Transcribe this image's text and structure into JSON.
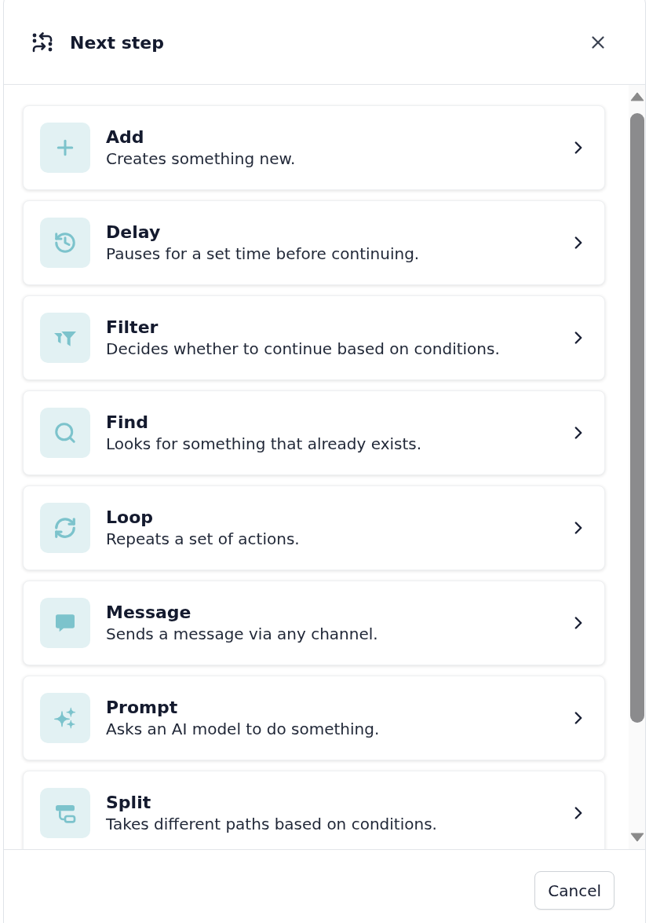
{
  "dialog": {
    "title": "Next step"
  },
  "steps": [
    {
      "kind": "add",
      "title": "Add",
      "description": "Creates something new."
    },
    {
      "kind": "delay",
      "title": "Delay",
      "description": "Pauses for a set time before continuing."
    },
    {
      "kind": "filter",
      "title": "Filter",
      "description": "Decides whether to continue based on conditions."
    },
    {
      "kind": "find",
      "title": "Find",
      "description": "Looks for something that already exists."
    },
    {
      "kind": "loop",
      "title": "Loop",
      "description": "Repeats a set of actions."
    },
    {
      "kind": "message",
      "title": "Message",
      "description": "Sends a message via any channel."
    },
    {
      "kind": "prompt",
      "title": "Prompt",
      "description": "Asks an AI model to do something."
    },
    {
      "kind": "split",
      "title": "Split",
      "description": "Takes different paths based on conditions."
    }
  ],
  "footer": {
    "buttons": [
      "Cancel"
    ]
  }
}
